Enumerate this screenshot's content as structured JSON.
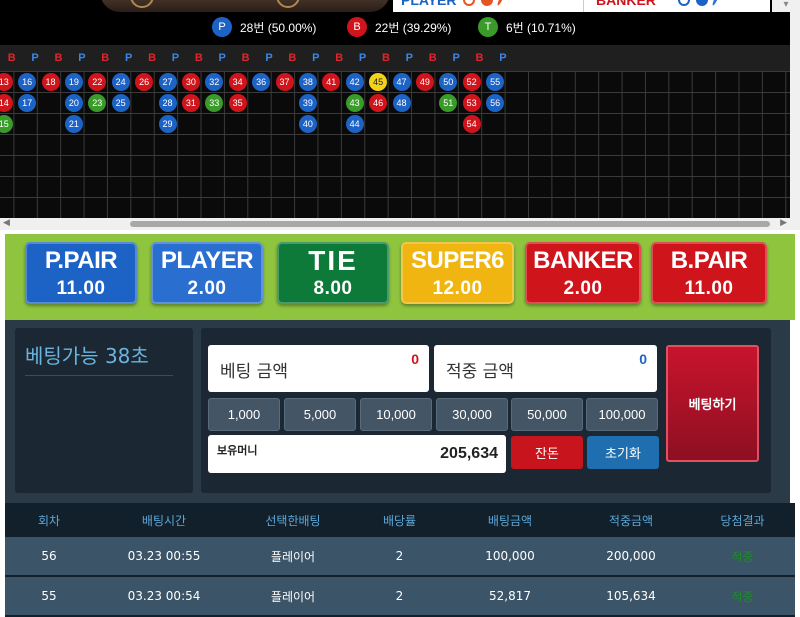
{
  "legend": {
    "player_label": "PLAYER",
    "banker_label": "BANKER",
    "dot_colors": [
      "#e65424",
      "#1d63c6",
      "#2a79d6"
    ]
  },
  "stats": [
    {
      "badge": "P",
      "text": "28번 (50.00%)",
      "color": "#1d63c6"
    },
    {
      "badge": "B",
      "text": "22번 (39.29%)",
      "color": "#d0141c"
    },
    {
      "badge": "T",
      "text": "6번 (10.71%)",
      "color": "#3a9a2a"
    }
  ],
  "road": {
    "sequence": [
      "B",
      "P",
      "B",
      "P",
      "B",
      "P",
      "B",
      "P",
      "B",
      "P",
      "B",
      "P",
      "B",
      "P",
      "B",
      "P",
      "B",
      "P",
      "B",
      "P",
      "B",
      "P"
    ],
    "colors": {
      "P": "#1d63c6",
      "B": "#d0141c",
      "T": "#3a9a2a",
      "Y": "#f2d21a"
    },
    "beads": [
      {
        "col": 0,
        "row": 0,
        "n": "13",
        "r": "B"
      },
      {
        "col": 0,
        "row": 1,
        "n": "14",
        "r": "B"
      },
      {
        "col": 0,
        "row": 2,
        "n": "15",
        "r": "T"
      },
      {
        "col": 1,
        "row": 0,
        "n": "16",
        "r": "P"
      },
      {
        "col": 1,
        "row": 1,
        "n": "17",
        "r": "P"
      },
      {
        "col": 2,
        "row": 0,
        "n": "18",
        "r": "B"
      },
      {
        "col": 3,
        "row": 0,
        "n": "19",
        "r": "P"
      },
      {
        "col": 3,
        "row": 1,
        "n": "20",
        "r": "P"
      },
      {
        "col": 3,
        "row": 2,
        "n": "21",
        "r": "P"
      },
      {
        "col": 4,
        "row": 0,
        "n": "22",
        "r": "B"
      },
      {
        "col": 4,
        "row": 1,
        "n": "23",
        "r": "T"
      },
      {
        "col": 5,
        "row": 0,
        "n": "24",
        "r": "P"
      },
      {
        "col": 5,
        "row": 1,
        "n": "25",
        "r": "P"
      },
      {
        "col": 6,
        "row": 0,
        "n": "26",
        "r": "B"
      },
      {
        "col": 7,
        "row": 0,
        "n": "27",
        "r": "P"
      },
      {
        "col": 7,
        "row": 1,
        "n": "28",
        "r": "P"
      },
      {
        "col": 7,
        "row": 2,
        "n": "29",
        "r": "P"
      },
      {
        "col": 8,
        "row": 0,
        "n": "30",
        "r": "B"
      },
      {
        "col": 8,
        "row": 1,
        "n": "31",
        "r": "B"
      },
      {
        "col": 9,
        "row": 0,
        "n": "32",
        "r": "P"
      },
      {
        "col": 9,
        "row": 1,
        "n": "33",
        "r": "T"
      },
      {
        "col": 10,
        "row": 0,
        "n": "34",
        "r": "B"
      },
      {
        "col": 10,
        "row": 1,
        "n": "35",
        "r": "B"
      },
      {
        "col": 11,
        "row": 0,
        "n": "36",
        "r": "P"
      },
      {
        "col": 12,
        "row": 0,
        "n": "37",
        "r": "B"
      },
      {
        "col": 13,
        "row": 0,
        "n": "38",
        "r": "P"
      },
      {
        "col": 13,
        "row": 1,
        "n": "39",
        "r": "P"
      },
      {
        "col": 13,
        "row": 2,
        "n": "40",
        "r": "P"
      },
      {
        "col": 14,
        "row": 0,
        "n": "41",
        "r": "B"
      },
      {
        "col": 15,
        "row": 0,
        "n": "42",
        "r": "P"
      },
      {
        "col": 15,
        "row": 1,
        "n": "43",
        "r": "T"
      },
      {
        "col": 15,
        "row": 2,
        "n": "44",
        "r": "P"
      },
      {
        "col": 16,
        "row": 0,
        "n": "45",
        "r": "Y"
      },
      {
        "col": 16,
        "row": 1,
        "n": "46",
        "r": "B"
      },
      {
        "col": 17,
        "row": 0,
        "n": "47",
        "r": "P"
      },
      {
        "col": 17,
        "row": 1,
        "n": "48",
        "r": "P"
      },
      {
        "col": 18,
        "row": 0,
        "n": "49",
        "r": "B"
      },
      {
        "col": 19,
        "row": 0,
        "n": "50",
        "r": "P"
      },
      {
        "col": 19,
        "row": 1,
        "n": "51",
        "r": "T"
      },
      {
        "col": 20,
        "row": 0,
        "n": "52",
        "r": "B"
      },
      {
        "col": 20,
        "row": 1,
        "n": "53",
        "r": "B"
      },
      {
        "col": 20,
        "row": 2,
        "n": "54",
        "r": "B"
      },
      {
        "col": 21,
        "row": 0,
        "n": "55",
        "r": "P"
      },
      {
        "col": 21,
        "row": 1,
        "n": "56",
        "r": "P"
      }
    ]
  },
  "bets": [
    {
      "label": "P.PAIR",
      "odds": "11.00",
      "bg": "#1d63c6"
    },
    {
      "label": "PLAYER",
      "odds": "2.00",
      "bg": "#2a6fd0"
    },
    {
      "label": "TIE",
      "odds": "8.00",
      "bg": "#0e7a3a"
    },
    {
      "label": "SUPER6",
      "odds": "12.00",
      "bg": "#f0b511"
    },
    {
      "label": "BANKER",
      "odds": "2.00",
      "bg": "#d0141c"
    },
    {
      "label": "B.PAIR",
      "odds": "11.00",
      "bg": "#d0141c"
    }
  ],
  "timer": "베팅가능 38초",
  "bet_amount": {
    "label": "베팅 금액",
    "value": "0"
  },
  "win_amount": {
    "label": "적중 금액",
    "value": "0"
  },
  "chips": [
    "1,000",
    "5,000",
    "10,000",
    "30,000",
    "50,000",
    "100,000"
  ],
  "money": {
    "label": "보유머니",
    "value": "205,634"
  },
  "change_button": "잔돈",
  "reset_button": "초기화",
  "place_button": "베팅하기",
  "history": {
    "columns": [
      "회차",
      "배팅시간",
      "선택한배팅",
      "배당률",
      "배팅금액",
      "적중금액",
      "당첨결과"
    ],
    "rows": [
      {
        "round": "56",
        "time": "03.23 00:55",
        "pick": "플레이어",
        "odds": "2",
        "bet": "100,000",
        "win": "200,000",
        "result": "적중"
      },
      {
        "round": "55",
        "time": "03.23 00:54",
        "pick": "플레이어",
        "odds": "2",
        "bet": "52,817",
        "win": "105,634",
        "result": "적중"
      }
    ]
  }
}
